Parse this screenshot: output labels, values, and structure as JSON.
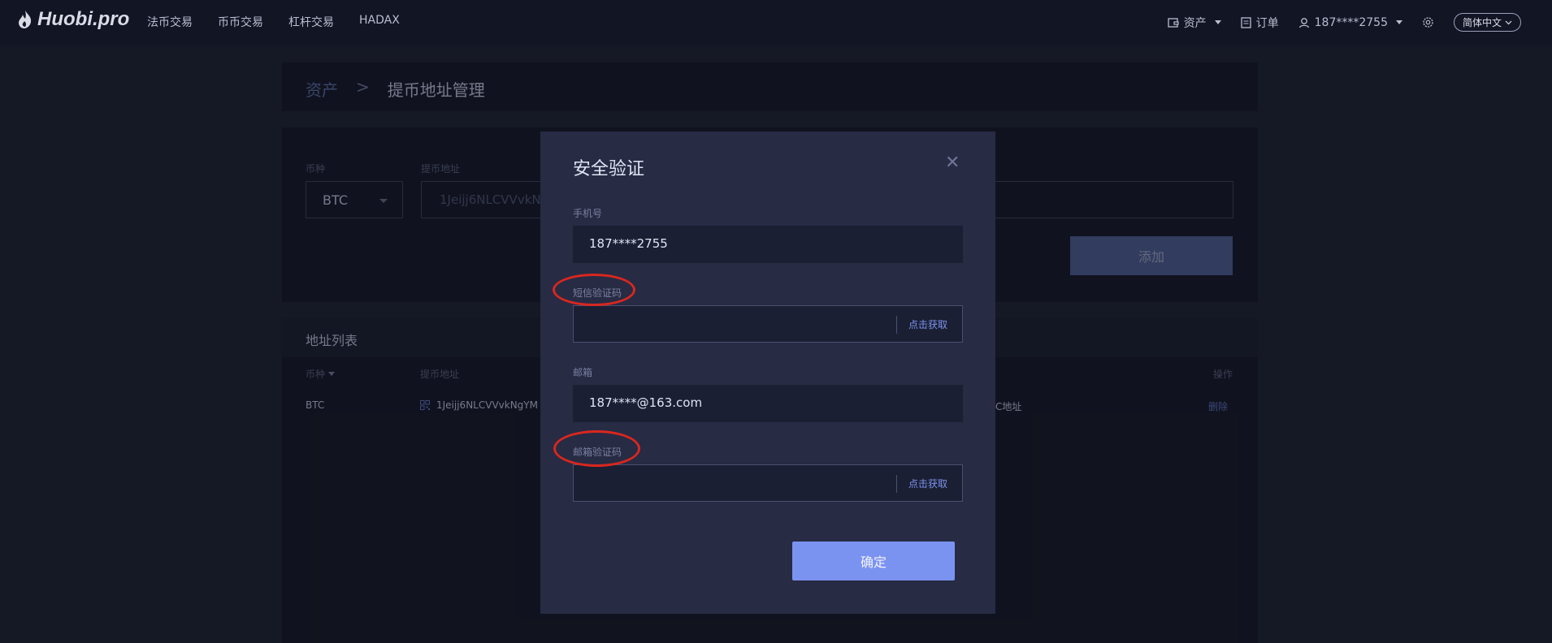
{
  "header": {
    "logo_text": "Huobi.pro",
    "nav": [
      "法币交易",
      "币币交易",
      "杠杆交易",
      "HADAX"
    ],
    "assets_label": "资产",
    "orders_label": "订单",
    "user_label": "187****2755",
    "language_label": "简体中文"
  },
  "breadcrumb": {
    "parent": "资产",
    "separator": ">",
    "current": "提币地址管理"
  },
  "form": {
    "coin_label": "币种",
    "coin_value": "BTC",
    "address_label": "提币地址",
    "address_value": "1Jeijj6NLCVVvkN",
    "add_button": "添加"
  },
  "address_list": {
    "title": "地址列表",
    "headers": {
      "coin": "币种",
      "address": "提币地址",
      "action": "操作"
    },
    "row": {
      "coin": "BTC",
      "address": "1Jeijj6NLCVVvkNgYM",
      "note_fragment": "C地址",
      "action": "删除"
    }
  },
  "modal": {
    "title": "安全验证",
    "phone_label": "手机号",
    "phone_value": "187****2755",
    "sms_label": "短信验证码",
    "sms_get": "点击获取",
    "email_label": "邮箱",
    "email_value": "187****@163.com",
    "email_code_label": "邮箱验证码",
    "email_get": "点击获取",
    "confirm": "确定"
  },
  "colors": {
    "page_bg": "#1a1e2e",
    "panel_bg": "#121524",
    "modal_bg": "#272b44",
    "primary_button": "#7b93f0",
    "link": "#5f74c7",
    "annotation": "#d8271f"
  }
}
